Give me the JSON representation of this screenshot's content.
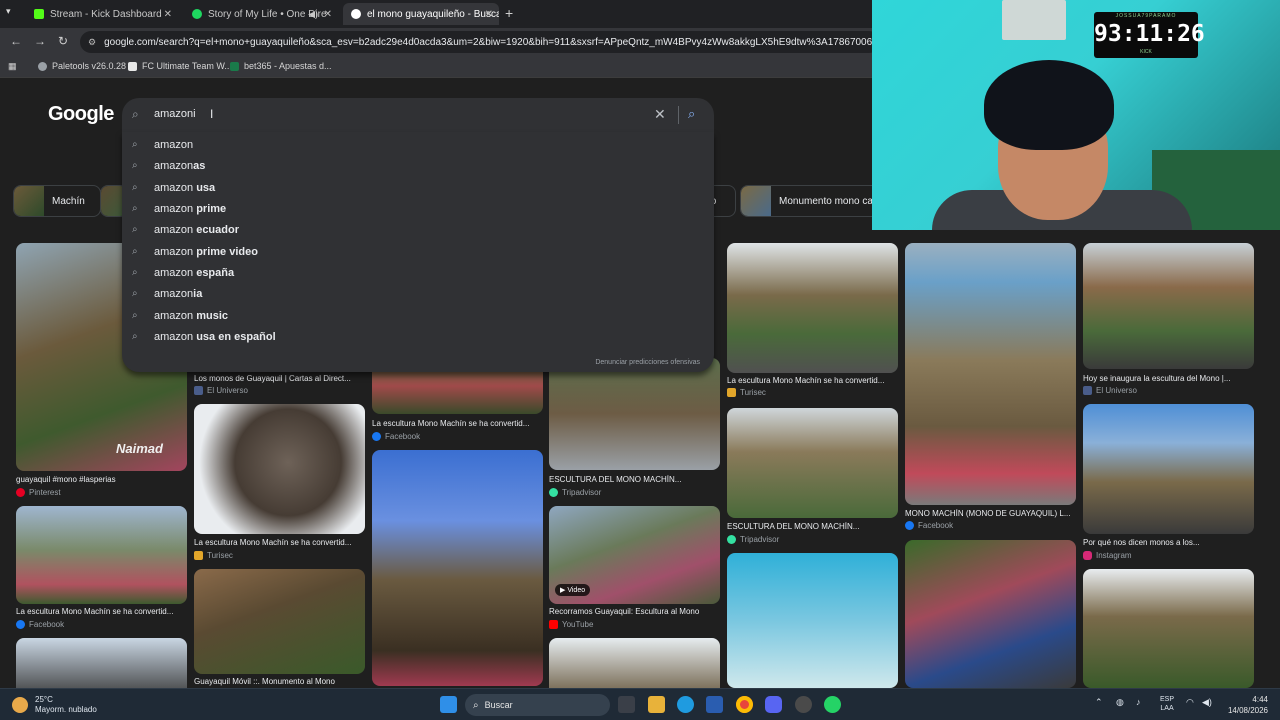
{
  "tabs": [
    {
      "title": "Stream - Kick Dashboard",
      "favicon": "kick-icon",
      "color": "#53fc18"
    },
    {
      "title": "Story of My Life • One Dire",
      "favicon": "spotify-icon",
      "color": "#1ed760"
    },
    {
      "title": "el mono guayaquileño - Buscar",
      "favicon": "google-icon",
      "color": "#ffffff"
    }
  ],
  "omnibox": {
    "url": "google.com/search?q=el+mono+guayaquileño&sca_esv=b2adc29e4d0acda3&um=2&biw=1920&bih=911&sxsrf=APpeQntz_mW4BPvy4zWw8akkgLX5hE9dtw%3A1786700613127&ei="
  },
  "bookmarks": [
    {
      "label": "Paletools v26.0.28"
    },
    {
      "label": "FC Ultimate Team W..."
    },
    {
      "label": "bet365 - Apuestas d..."
    }
  ],
  "google": {
    "logo": "Google",
    "query": "amazoni",
    "suggestions": [
      {
        "prefix": "amazon",
        "suffix": ""
      },
      {
        "prefix": "amazon",
        "suffix": "as"
      },
      {
        "prefix": "amazon",
        "suffix": " usa"
      },
      {
        "prefix": "amazon",
        "suffix": " prime"
      },
      {
        "prefix": "amazon",
        "suffix": " ecuador"
      },
      {
        "prefix": "amazon",
        "suffix": " prime video"
      },
      {
        "prefix": "amazon",
        "suffix": " españa"
      },
      {
        "prefix": "amazon",
        "suffix": "ia"
      },
      {
        "prefix": "amazon",
        "suffix": " music"
      },
      {
        "prefix": "amazon",
        "suffix": " usa en español"
      }
    ],
    "report_text": "Denunciar predicciones ofensivas",
    "chips": [
      {
        "label": "Machín"
      },
      {
        "label": "to"
      },
      {
        "label": "Monumento mono ca"
      }
    ],
    "results": [
      {
        "caption": "guayaquil #mono #lasperias",
        "source": "Pinterest",
        "src_color": "#e60023"
      },
      {
        "caption": "La escultura Mono Machín se ha convertid...",
        "source": "Facebook",
        "src_color": "#1877f2"
      },
      {
        "caption": "Los monos de Guayaquil | Cartas al Direct...",
        "source": "El Universo",
        "src_color": "#4a5d8a"
      },
      {
        "caption": "La escultura Mono Machín se ha convertid...",
        "source": "Turisec",
        "src_color": "#e2a62a"
      },
      {
        "caption": "Guayaquil Móvil ::. Monumento al Mono",
        "source": "",
        "src_color": "#888888"
      },
      {
        "caption": "La escultura Mono Machín se ha convertid...",
        "source": "Facebook",
        "src_color": "#1877f2"
      },
      {
        "caption": "ESCULTURA DEL MONO MACHÍN...",
        "source": "Tripadvisor",
        "src_color": "#34e0a1"
      },
      {
        "caption": "Recorramos Guayaquil: Escultura al Mono",
        "source": "YouTube",
        "src_color": "#ff0000"
      },
      {
        "caption": "La escultura Mono Machín se ha convertid...",
        "source": "Turisec",
        "src_color": "#e2a62a"
      },
      {
        "caption": "ESCULTURA DEL MONO MACHÍN...",
        "source": "Tripadvisor",
        "src_color": "#34e0a1"
      },
      {
        "caption": "MONO MACHÍN (MONO DE GUAYAQUIL) L...",
        "source": "Facebook",
        "src_color": "#1877f2"
      },
      {
        "caption": "Hoy se inaugura la escultura del Mono |...",
        "source": "El Universo",
        "src_color": "#4a5d8a"
      },
      {
        "caption": "Por qué nos dicen monos a los...",
        "source": "Instagram",
        "src_color": "#d62976"
      }
    ],
    "video_badge": "Video",
    "watermark": "Naimad"
  },
  "webcam": {
    "timer_label": "JOSSUA79PARAMO",
    "timer": "93:11:26",
    "timer_footer": "KICK"
  },
  "taskbar": {
    "temp": "25°C",
    "weather": "Mayorm. nublado",
    "search_placeholder": "Buscar",
    "lang_top": "ESP",
    "lang_bottom": "LAA",
    "time": "4:44",
    "date": "14/08/2026"
  }
}
